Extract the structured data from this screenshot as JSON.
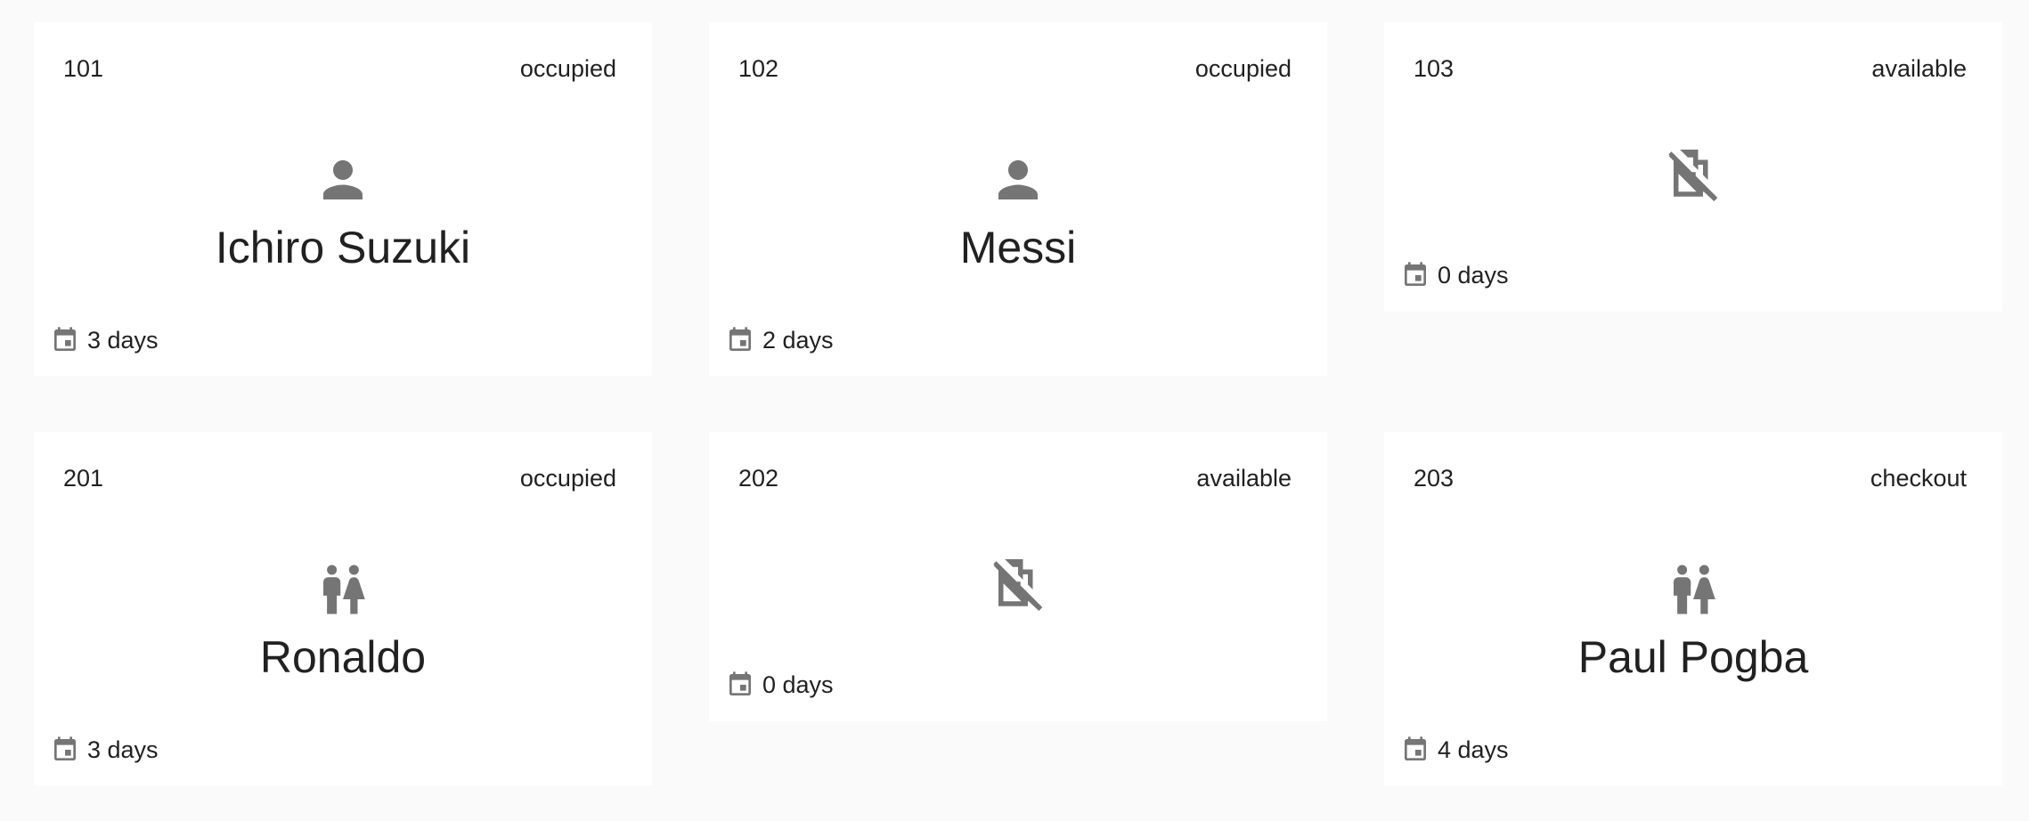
{
  "rooms": [
    {
      "number": "101",
      "status": "occupied",
      "guest": "Ichiro Suzuki",
      "occupancy_icon": "person-icon",
      "stay": "3 days",
      "calendar_icon": "calendar-icon"
    },
    {
      "number": "102",
      "status": "occupied",
      "guest": "Messi",
      "occupancy_icon": "person-icon",
      "stay": "2 days",
      "calendar_icon": "calendar-icon"
    },
    {
      "number": "103",
      "status": "available",
      "guest": "",
      "occupancy_icon": "no-meeting-room-icon",
      "stay": "0 days",
      "calendar_icon": "calendar-icon"
    },
    {
      "number": "201",
      "status": "occupied",
      "guest": "Ronaldo",
      "occupancy_icon": "couple-icon",
      "stay": "3 days",
      "calendar_icon": "calendar-icon"
    },
    {
      "number": "202",
      "status": "available",
      "guest": "",
      "occupancy_icon": "no-meeting-room-icon",
      "stay": "0 days",
      "calendar_icon": "calendar-icon"
    },
    {
      "number": "203",
      "status": "checkout",
      "guest": "Paul Pogba",
      "occupancy_icon": "couple-icon",
      "stay": "4 days",
      "calendar_icon": "calendar-icon"
    }
  ],
  "colors": {
    "background": "#fafafa",
    "card": "#ffffff",
    "icon": "#757575",
    "text": "#212121"
  }
}
